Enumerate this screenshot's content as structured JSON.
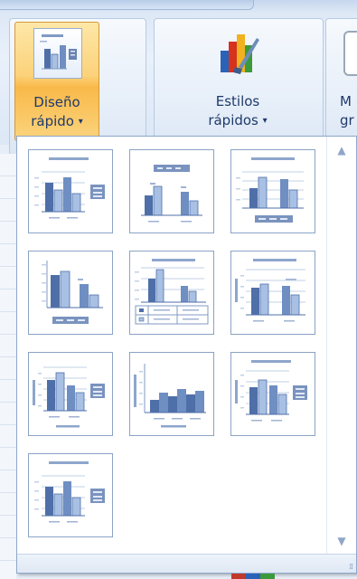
{
  "ribbon": {
    "quick_layout": {
      "label_line1": "Diseño",
      "label_line2": "rápido",
      "caret": "▾",
      "icon": "quick-layout-chart-icon",
      "state": "pressed"
    },
    "quick_styles": {
      "label_line1": "Estilos",
      "label_line2": "rápidos",
      "caret": "▾",
      "icon": "chart-styles-paintbrush-icon"
    },
    "partial_button": {
      "label_line1": "M",
      "label_line2": "gr"
    }
  },
  "gallery": {
    "layouts": [
      {
        "name": "layout-1",
        "icon": "chart-layout-title-legend-right-icon"
      },
      {
        "name": "layout-2",
        "icon": "chart-layout-legend-top-icon"
      },
      {
        "name": "layout-3",
        "icon": "chart-layout-title-legend-bottom-icon"
      },
      {
        "name": "layout-4",
        "icon": "chart-layout-legend-bottom-icon"
      },
      {
        "name": "layout-5",
        "icon": "chart-layout-data-table-icon"
      },
      {
        "name": "layout-6",
        "icon": "chart-layout-axis-title-icon"
      },
      {
        "name": "layout-7",
        "icon": "chart-layout-axis-titles-legend-icon"
      },
      {
        "name": "layout-8",
        "icon": "chart-layout-no-gap-columns-icon"
      },
      {
        "name": "layout-9",
        "icon": "chart-layout-titles-legend-right-icon"
      },
      {
        "name": "layout-10",
        "icon": "chart-layout-title-legend-right-alt-icon"
      }
    ],
    "scroll_up": "▲",
    "scroll_down": "▼",
    "grip": "⁞⁞"
  },
  "colors": {
    "accent": "#f9b94a",
    "bar_dark": "#4f6fa8",
    "bar_light": "#a8c0e4",
    "line": "#7f9ac4"
  }
}
